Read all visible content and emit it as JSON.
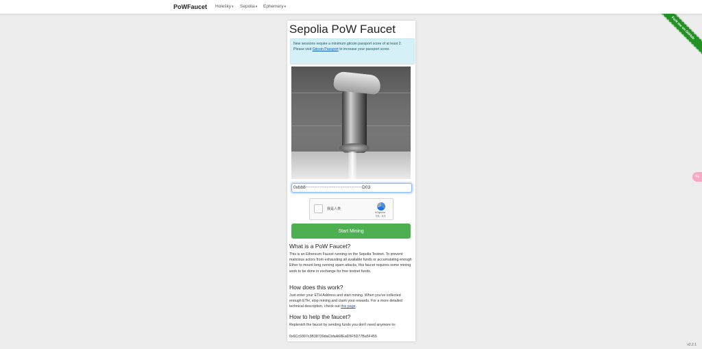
{
  "nav": {
    "brand": "PoWFaucet",
    "items": [
      {
        "label": "Holešky"
      },
      {
        "label": "Sepolia"
      },
      {
        "label": "Ephemery"
      }
    ]
  },
  "ribbon": {
    "label": "Fork me on GitHub"
  },
  "card": {
    "title": "Sepolia PoW Faucet",
    "alert": {
      "line1": "New sessions require a minimum gitcoin passport score of at least 2.",
      "line2_prefix": "Please visit ",
      "link": "Gitcoin Passport",
      "line2_suffix": " to increase your passport score."
    },
    "address": {
      "prefix": "0xbb8",
      "masked": "••••••••••••••••••••••••••••••••",
      "suffix": "D03"
    },
    "captcha": {
      "label": "我是人类",
      "brand": "hCaptcha",
      "terms": "隐私 - 条款"
    },
    "start_button": "Start Mining",
    "sections": [
      {
        "heading": "What is a PoW Faucet?",
        "text": "This is an Ethereum Faucet running on the Sepolia Testnet. To prevent malicious actors from exhausting all available funds or accumulating enough Ether to mount long running spam attacks, this faucet requires some mining work to be done in exchange for free testnet funds."
      },
      {
        "heading": "How does this work?",
        "text_prefix": "Just enter your ETH Address and start mining. When you've collected enough ETH, stop mining and claim your rewards. For a more detailed technical description, check out ",
        "link": "this page",
        "text_suffix": "."
      },
      {
        "heading": "How to help the faucet?",
        "text": "Replenish the faucet by sending funds you don't need anymore to:",
        "address": "0x6Cc9397c3B38739daCbfaA68EaD5F5D77Ba5F455"
      }
    ]
  },
  "version": "v2.2.1",
  "colors": {
    "accent": "#4caf50",
    "alert_bg": "#d6f0f7",
    "ribbon": "#239023"
  }
}
